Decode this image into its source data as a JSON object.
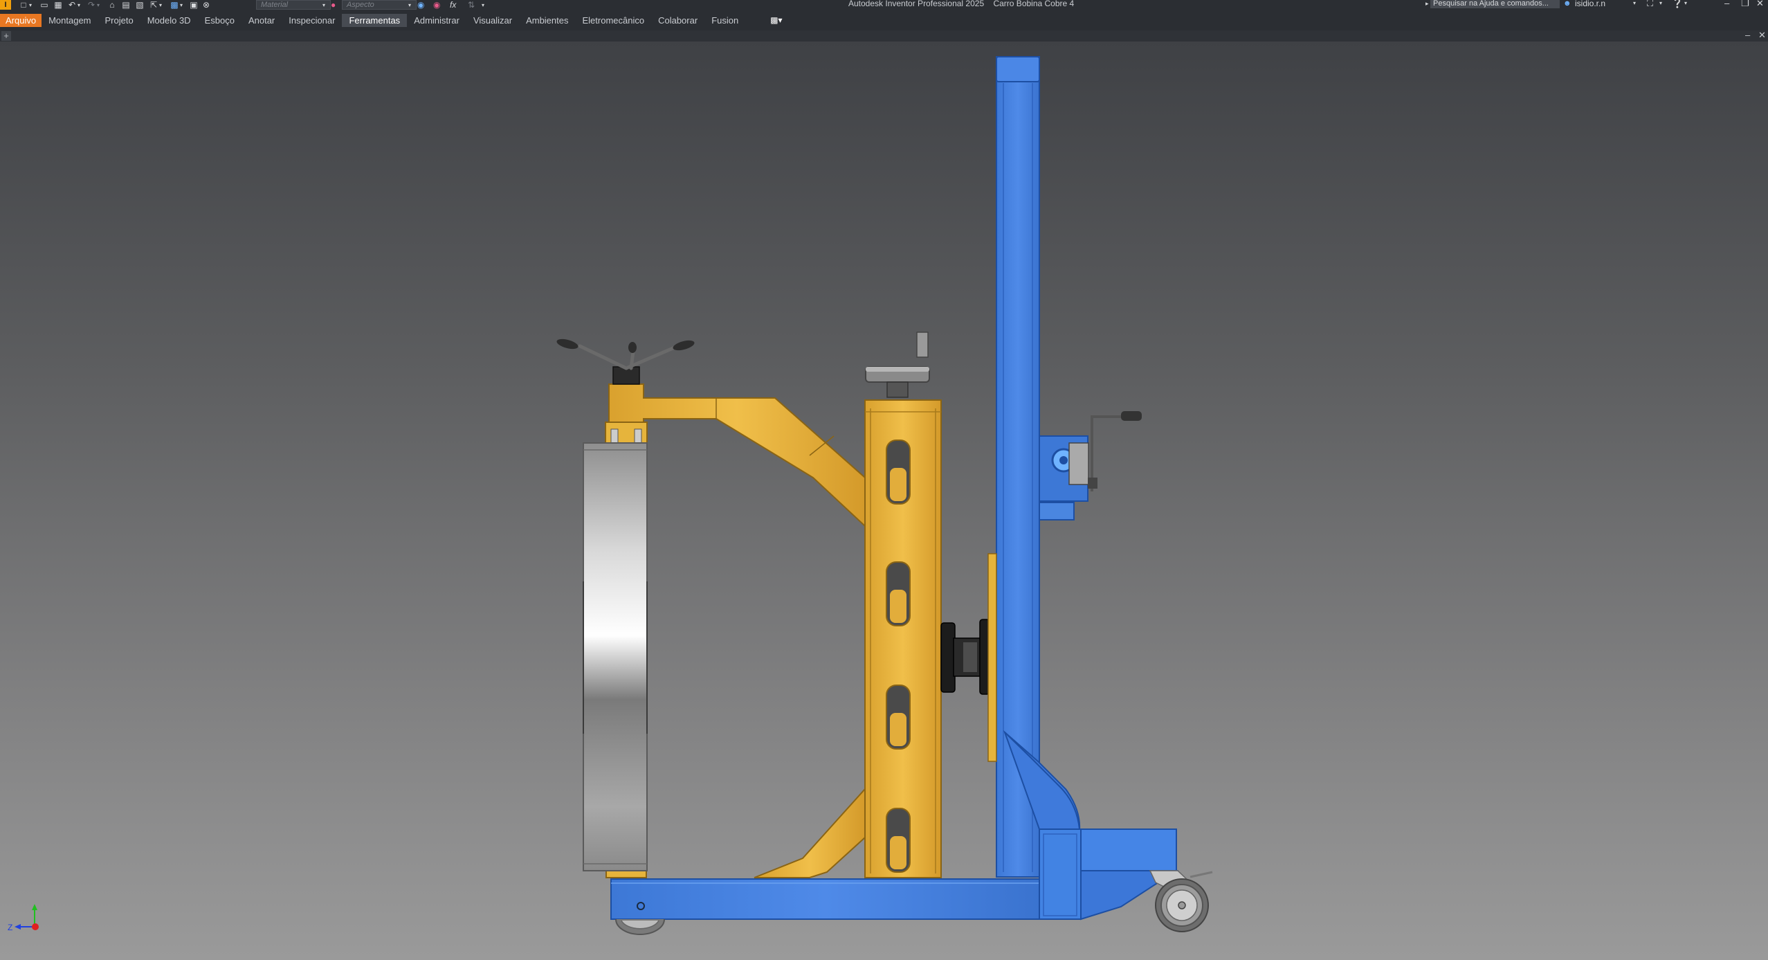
{
  "app": {
    "title": "Autodesk Inventor Professional 2025",
    "document_name": "Carro Bobina Cobre 4",
    "logo": "I"
  },
  "quick_access": {
    "material_placeholder": "Material",
    "appearance_placeholder": "Aspecto",
    "fx_label": "fx"
  },
  "help_search": {
    "placeholder": "Pesquisar na Ajuda e comandos..."
  },
  "user": {
    "name": "isidio.r.n"
  },
  "ribbon": {
    "tabs": [
      {
        "label": "Arquivo"
      },
      {
        "label": "Montagem"
      },
      {
        "label": "Projeto"
      },
      {
        "label": "Modelo 3D"
      },
      {
        "label": "Esboço"
      },
      {
        "label": "Anotar"
      },
      {
        "label": "Inspecionar"
      },
      {
        "label": "Ferramentas"
      },
      {
        "label": "Administrar"
      },
      {
        "label": "Visualizar"
      },
      {
        "label": "Ambientes"
      },
      {
        "label": "Eletromecânico"
      },
      {
        "label": "Colaborar"
      },
      {
        "label": "Fusion"
      }
    ],
    "active_tab": "Ferramentas"
  },
  "document_tabs": {
    "new_tab_label": "+"
  },
  "viewport": {
    "triad_axis_label": "Z",
    "colors": {
      "frame_blue": "#4a86e0",
      "frame_yellow": "#e6b43c",
      "coil_silver": "#c8c8c8",
      "axis_x": "#e02020",
      "axis_y": "#20c020",
      "axis_z": "#2040e0"
    }
  },
  "icons": [
    "app-logo-icon",
    "new-icon",
    "open-icon",
    "save-icon",
    "undo-icon",
    "redo-icon",
    "home-icon",
    "print-icon",
    "measure-icon",
    "select-icon",
    "update-icon",
    "material-icon",
    "appearance-icon",
    "fx-icon",
    "help-icon",
    "cart-icon",
    "user-icon"
  ]
}
